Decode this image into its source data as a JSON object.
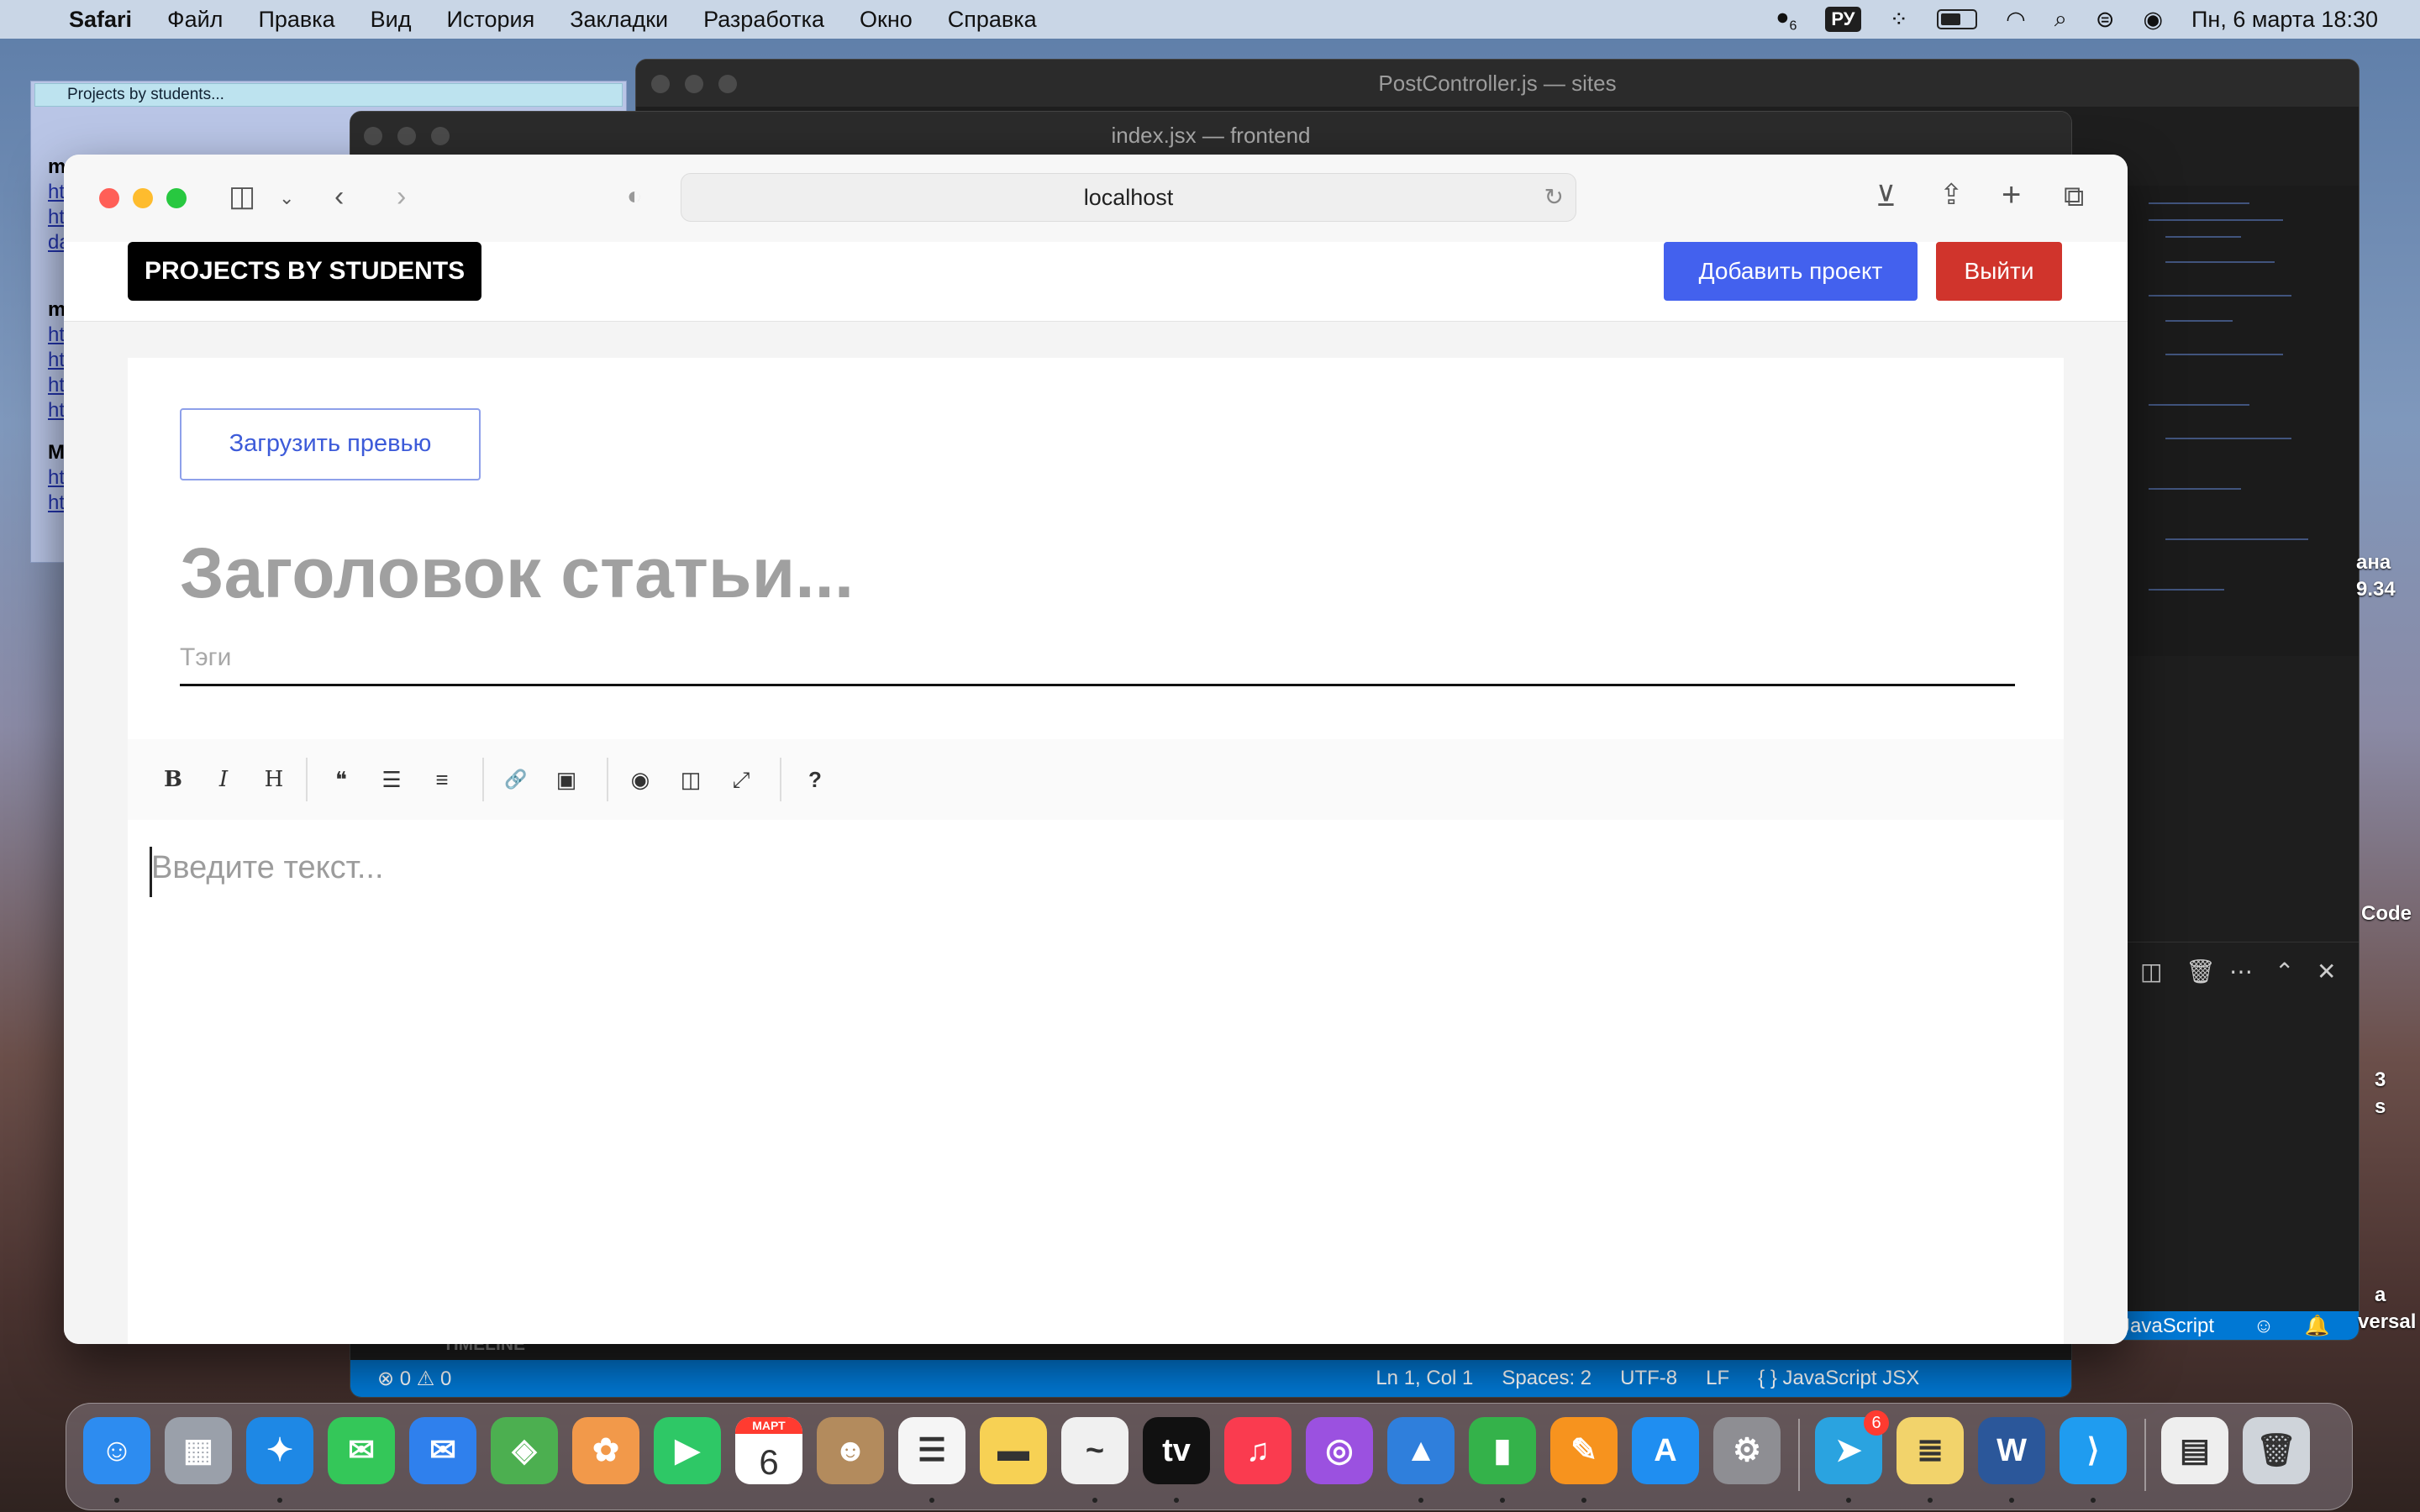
{
  "menubar": {
    "apple": "",
    "app": "Safari",
    "items": [
      "Файл",
      "Правка",
      "Вид",
      "История",
      "Закладки",
      "Разработка",
      "Окно",
      "Справка"
    ],
    "input_lang": "РУ",
    "notif_count": "6",
    "datetime": "Пн, 6 марта  18:30",
    "battery_level": 0.6
  },
  "bg_note": {
    "tab": "Projects by students...",
    "lines": [
      "m",
      "ht",
      "ht",
      "da",
      "m",
      "ht",
      "ht",
      "ht",
      "ht",
      "M",
      "ht",
      "ht"
    ]
  },
  "vscode_back": {
    "title": "PostController.js — sites",
    "status_lang": "JavaScript",
    "desk_texts": [
      "ана",
      "9.34",
      "Code",
      "3",
      "s",
      "а",
      "versal"
    ]
  },
  "vscode_front": {
    "title": "index.jsx — frontend",
    "timeline": "TIMELINE",
    "status": {
      "problems": "⊗ 0 ⚠ 0",
      "position": "Ln 1, Col 1",
      "spaces": "Spaces: 2",
      "encoding": "UTF-8",
      "eol": "LF",
      "language": "{ }  JavaScript JSX"
    }
  },
  "safari": {
    "url": "localhost",
    "colors": {
      "close": "#ff5f57",
      "min": "#febc2e",
      "max": "#28c840"
    }
  },
  "site": {
    "logo": "PROJECTS BY STUDENTS",
    "add_project": "Добавить проект",
    "logout": "Выйти",
    "colors": {
      "primary": "#4361ee",
      "danger": "#d0342c"
    }
  },
  "editor": {
    "upload_preview": "Загрузить превью",
    "title_placeholder": "Заголовок статьи...",
    "tags_placeholder": "Тэги",
    "body_placeholder": "Введите текст...",
    "toolbar": [
      {
        "name": "bold",
        "glyph": "B"
      },
      {
        "name": "italic",
        "glyph": "I"
      },
      {
        "name": "heading",
        "glyph": "H"
      },
      {
        "name": "quote",
        "glyph": "❝"
      },
      {
        "name": "unordered-list",
        "glyph": "☰"
      },
      {
        "name": "ordered-list",
        "glyph": "≡"
      },
      {
        "name": "link",
        "glyph": "🔗"
      },
      {
        "name": "image",
        "glyph": "▣"
      },
      {
        "name": "preview",
        "glyph": "◉"
      },
      {
        "name": "side-by-side",
        "glyph": "◫"
      },
      {
        "name": "fullscreen",
        "glyph": "⤢"
      },
      {
        "name": "guide",
        "glyph": "?"
      }
    ]
  },
  "dock": {
    "apps": [
      {
        "name": "finder",
        "glyph": "☺",
        "color": "#2d8cf0"
      },
      {
        "name": "launchpad",
        "glyph": "▦",
        "color": "#9aa0aa"
      },
      {
        "name": "safari",
        "glyph": "✦",
        "color": "#1e88e5"
      },
      {
        "name": "messages",
        "glyph": "✉",
        "color": "#34c759"
      },
      {
        "name": "mail",
        "glyph": "✉",
        "color": "#2f80ed"
      },
      {
        "name": "maps",
        "glyph": "◈",
        "color": "#4caf50"
      },
      {
        "name": "photos",
        "glyph": "✿",
        "color": "#f2994a"
      },
      {
        "name": "facetime",
        "glyph": "▶",
        "color": "#2ec866"
      },
      {
        "name": "calendar",
        "glyph": "6",
        "color": "#ffffff",
        "caption": "МАРТ"
      },
      {
        "name": "contacts",
        "glyph": "☻",
        "color": "#b38b5d"
      },
      {
        "name": "reminders",
        "glyph": "☰",
        "color": "#f5f5f5"
      },
      {
        "name": "notes",
        "glyph": "▬",
        "color": "#f7d154"
      },
      {
        "name": "freeform",
        "glyph": "~",
        "color": "#f0f0f0"
      },
      {
        "name": "apple-tv",
        "glyph": "tv",
        "color": "#111111"
      },
      {
        "name": "music",
        "glyph": "♫",
        "color": "#fa3b4f"
      },
      {
        "name": "podcasts",
        "glyph": "◎",
        "color": "#9b51e0"
      },
      {
        "name": "keynote",
        "glyph": "▲",
        "color": "#2f7fdc"
      },
      {
        "name": "numbers",
        "glyph": "▮",
        "color": "#34b24a"
      },
      {
        "name": "pages",
        "glyph": "✎",
        "color": "#f7931e"
      },
      {
        "name": "app-store",
        "glyph": "A",
        "color": "#1f8ef1"
      },
      {
        "name": "system-settings",
        "glyph": "⚙",
        "color": "#8e8e93"
      },
      {
        "name": "telegram",
        "glyph": "➤",
        "color": "#2aa3e0",
        "badge": "6"
      },
      {
        "name": "stickies",
        "glyph": "≣",
        "color": "#f2d36b"
      },
      {
        "name": "word",
        "glyph": "W",
        "color": "#2b579a"
      },
      {
        "name": "vscode",
        "glyph": "⟩",
        "color": "#1f9cf0"
      },
      {
        "name": "document",
        "glyph": "▤",
        "color": "#eeeeee"
      },
      {
        "name": "trash",
        "glyph": "🗑",
        "color": "#cfd4da"
      }
    ]
  }
}
